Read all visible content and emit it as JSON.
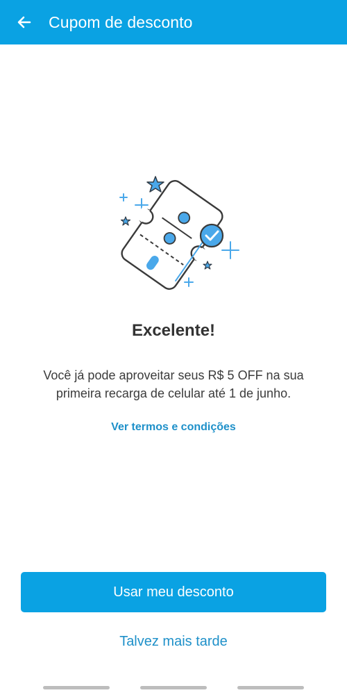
{
  "colors": {
    "app_bar": "#0aa2e3",
    "primary_button": "#0aa2e3",
    "link": "#1e90c9",
    "illustration_accent": "#4aa8ea",
    "illustration_outline": "#3a3a3a"
  },
  "header": {
    "back_icon": "arrow-left-icon",
    "title": "Cupom de desconto"
  },
  "illustration": {
    "icon": "discount-ticket-icon"
  },
  "content": {
    "heading": "Excelente!",
    "message": "Você já pode aproveitar seus R$ 5 OFF na sua primeira recarga de celular até 1 de junho.",
    "terms_link": "Ver termos e condições"
  },
  "actions": {
    "primary": "Usar meu desconto",
    "secondary": "Talvez mais tarde"
  }
}
